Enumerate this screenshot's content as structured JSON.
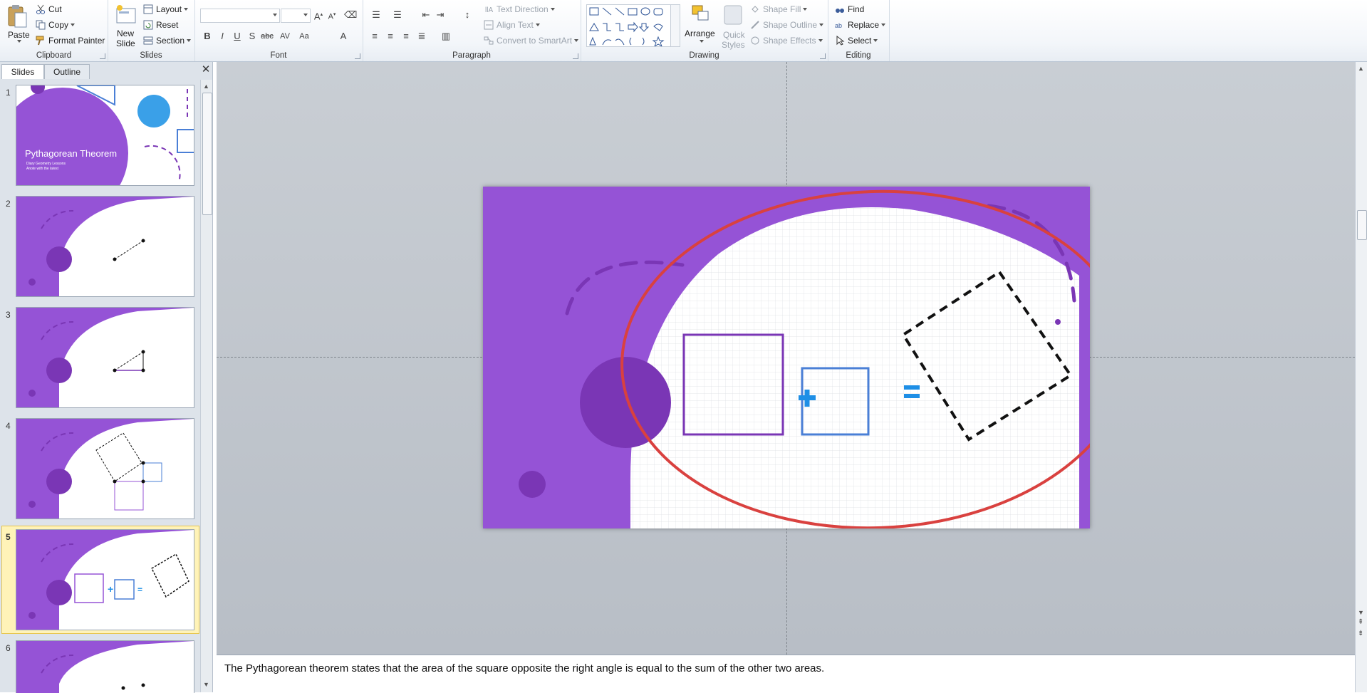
{
  "ribbon": {
    "clipboard": {
      "title": "Clipboard",
      "paste": "Paste",
      "cut": "Cut",
      "copy": "Copy",
      "format_painter": "Format Painter"
    },
    "slides": {
      "title": "Slides",
      "new_slide_line1": "New",
      "new_slide_line2": "Slide",
      "layout": "Layout",
      "reset": "Reset",
      "section": "Section"
    },
    "font": {
      "title": "Font"
    },
    "paragraph": {
      "title": "Paragraph",
      "text_direction": "Text Direction",
      "align_text": "Align Text",
      "convert_smartart": "Convert to SmartArt"
    },
    "drawing": {
      "title": "Drawing",
      "arrange": "Arrange",
      "quick_styles_line1": "Quick",
      "quick_styles_line2": "Styles",
      "shape_fill": "Shape Fill",
      "shape_outline": "Shape Outline",
      "shape_effects": "Shape Effects"
    },
    "editing": {
      "title": "Editing",
      "find": "Find",
      "replace": "Replace",
      "select": "Select"
    }
  },
  "panel": {
    "tab_slides": "Slides",
    "tab_outline": "Outline",
    "slide_numbers": [
      "1",
      "2",
      "3",
      "4",
      "5",
      "6"
    ],
    "slide1_title": "Pythagorean Theorem",
    "slide1_subtitle1": "Diary Geometry Lessons",
    "slide1_subtitle2": "Anote with the latest",
    "selected_slide": "5"
  },
  "notes": {
    "text": "The Pythagorean theorem states that the area of the square opposite the right angle is equal to the sum of the other two areas."
  },
  "colors": {
    "purple": "#9553d6",
    "dark_purple": "#7a36b5",
    "blue": "#4a7fd6",
    "plus_blue": "#1e8fe6",
    "annotation_red": "#d9413f"
  }
}
